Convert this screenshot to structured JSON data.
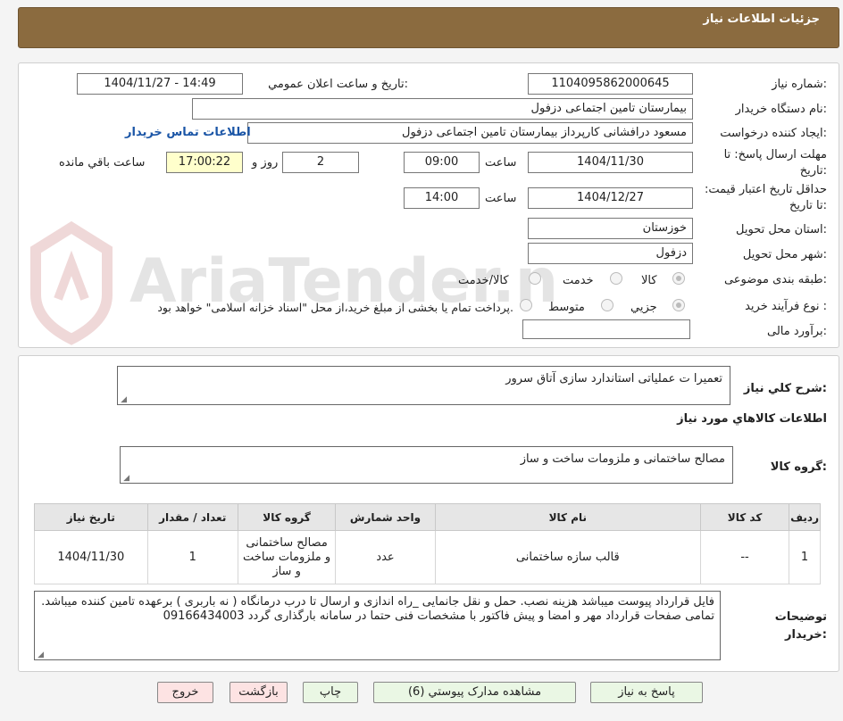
{
  "header": {
    "title": "جزئیات اطلاعات نیاز"
  },
  "form": {
    "need_number_label": "شماره نیاز:",
    "need_number": "1104095862000645",
    "announce_label": "تاریخ و ساعت اعلان عمومي:",
    "announce_value": "1404/11/27 - 14:49",
    "buyer_label": "نام دستگاه خريدار:",
    "buyer_value": "بیمارستان تامین اجتماعی دزفول",
    "creator_label": "ایجاد کننده درخواست:",
    "creator_value": "مسعود درافشانی کارپرداز بیمارستان تامین اجتماعی دزفول",
    "contact_link": "اطلاعات تماس خریدار",
    "deadline_label": "مهلت ارسال پاسخ: تا تاریخ:",
    "deadline_date": "1404/11/30",
    "hour_label": "ساعت",
    "deadline_time": "09:00",
    "remaining_days": "2",
    "days_label": "روز و",
    "remaining_time": "17:00:22",
    "remaining_label": "ساعت باقي مانده",
    "validity_label": "حداقل تاریخ اعتبار قیمت: تا تاریخ:",
    "validity_date": "1404/12/27",
    "validity_time": "14:00",
    "province_label": "استان محل تحویل:",
    "province_value": "خوزستان",
    "city_label": "شهر محل تحویل:",
    "city_value": "دزفول",
    "category_label": "طبقه بندی موضوعی:",
    "category_options": [
      "کالا",
      "خدمت",
      "کالا/خدمت"
    ],
    "process_label": "نوع فرآیند خرید :",
    "process_options": [
      "جزیي",
      "متوسط"
    ],
    "process_note": "پرداخت تمام يا بخشی از مبلغ خرید،از محل \"اسناد خزانه اسلامی\" خواهد بود.",
    "estimate_label": "برآورد مالی:",
    "estimate_value": ""
  },
  "details": {
    "general_desc_label": "شرح کلي نیاز:",
    "general_desc": "تعمیرا ت عملیاتی استاندارد سازی آتاق سرور",
    "goods_info_title": "اطلاعات کالاهاي مورد نیاز",
    "goods_group_label": "گروه کالا:",
    "goods_group_value": "مصالح ساختمانی و ملزومات ساخت و ساز",
    "table": {
      "headers": [
        "رديف",
        "کد کالا",
        "نام کالا",
        "واحد شمارش",
        "گروه کالا",
        "تعداد / مقدار",
        "تاریخ نیاز"
      ],
      "rows": [
        [
          "1",
          "--",
          "قالب سازه ساختمانی",
          "عدد",
          "مصالح ساختمانی و ملزومات ساخت و ساز",
          "1",
          "1404/11/30"
        ]
      ]
    },
    "buyer_notes_label": "توضيحات خریدار:",
    "buyer_notes": "فایل قرارداد پیوست میباشد هزینه نصب. حمل و نقل جانمایی _راه اندازی و ارسال تا درب درمانگاه ( نه  باربری ) برعهده تامین کننده میباشد. تمامی صفحات قرارداد مهر و امضا و پیش فاکتور با مشخصات فنی حتما در سامانه بارگذاری گردد 09166434003"
  },
  "buttons": {
    "reply": "پاسخ به نیاز",
    "attachments": "مشاهده مدارک پیوستي (6)",
    "print": "چاپ",
    "back": "بازگشت",
    "exit": "خروج"
  },
  "watermark": {
    "text": "AriaTender.neT"
  },
  "colors": {
    "header": "#8b6b3f",
    "link": "#1a55a6",
    "green_button": "#eaf7e4",
    "pink_button": "#fde3e3",
    "remaining_bg": "#ffffcc"
  }
}
